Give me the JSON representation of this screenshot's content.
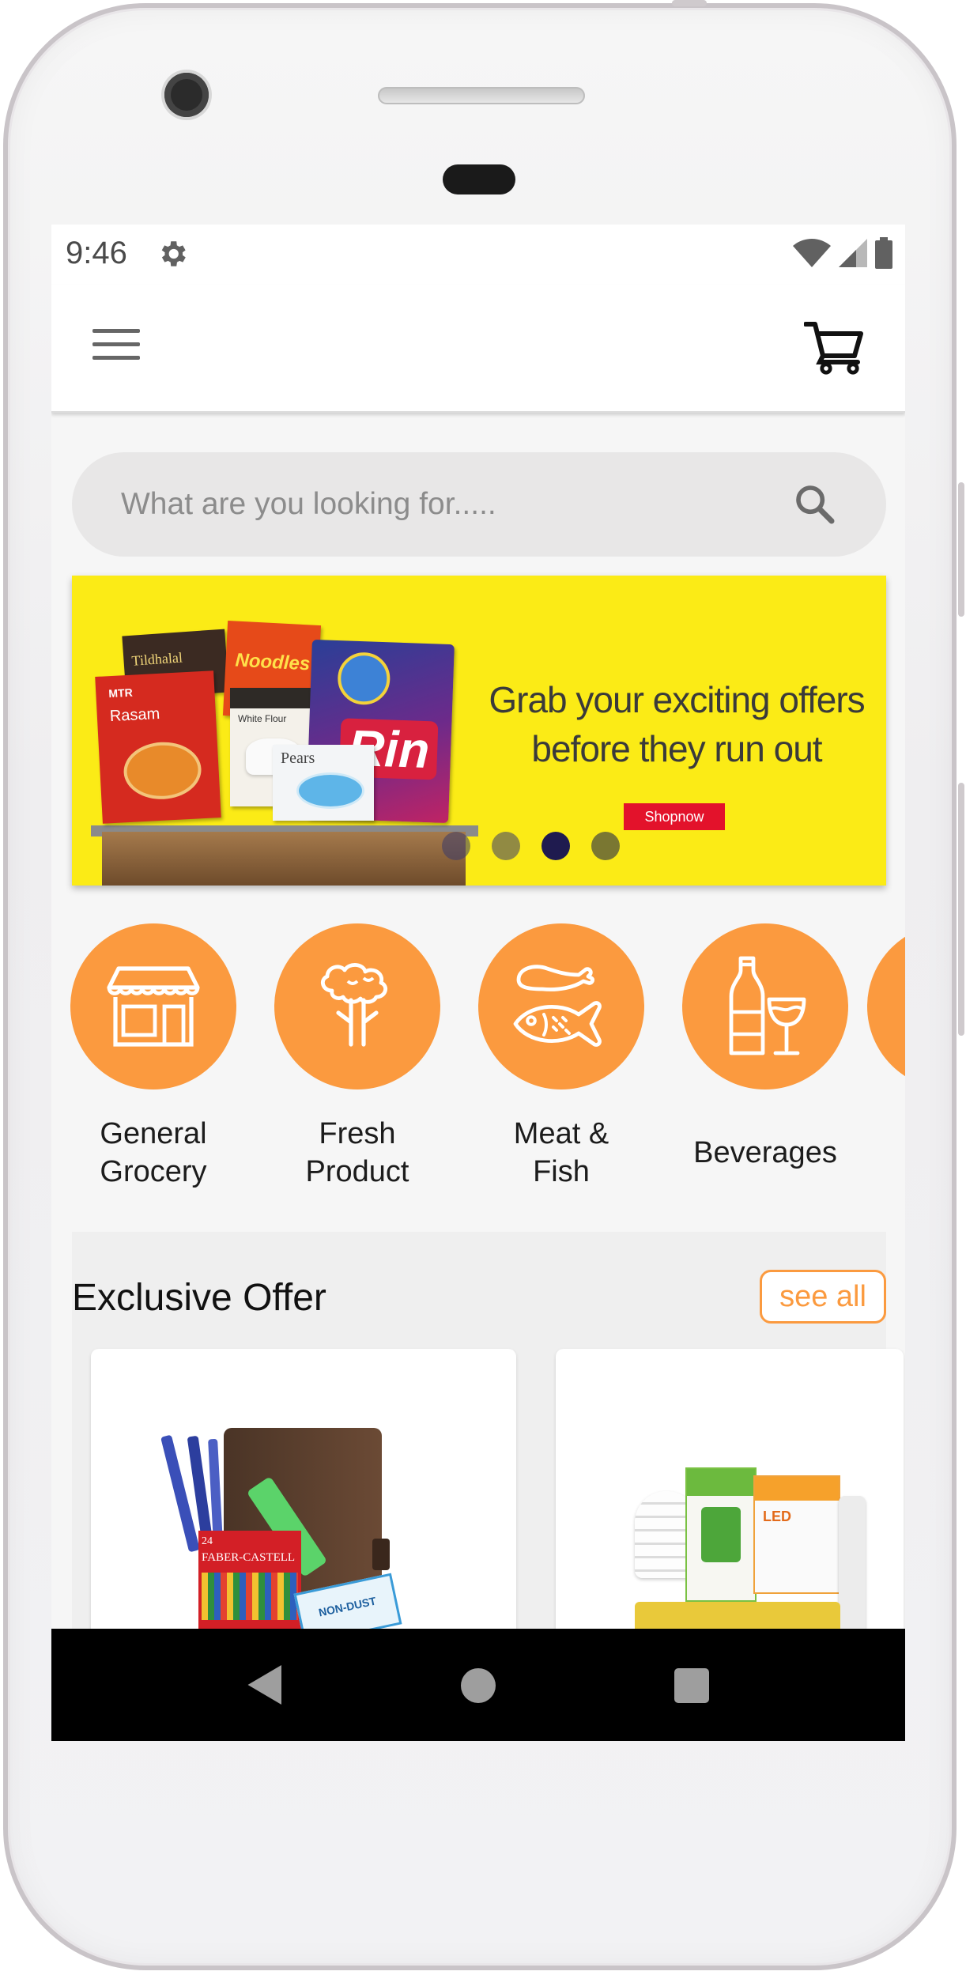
{
  "status_bar": {
    "time": "9:46",
    "icons": [
      "gear-icon",
      "wifi-icon",
      "signal-icon",
      "battery-icon"
    ]
  },
  "app_bar": {
    "menu_icon": "hamburger-menu-icon",
    "cart_icon": "shopping-cart-icon"
  },
  "search": {
    "placeholder": "What are you looking for.....",
    "value": "",
    "icon": "search-icon"
  },
  "banner": {
    "headline_line1": "Grab your exciting offers",
    "headline_line2": "before they run out",
    "cta_label": "Shopnow",
    "product_labels": [
      "Tildhalal",
      "Noodles",
      "Rasam",
      "MTR",
      "White Flour",
      "Pears",
      "Rin"
    ],
    "slide_count": 4,
    "active_slide": 3
  },
  "categories": [
    {
      "label": "General Grocery",
      "icon": "storefront-icon"
    },
    {
      "label": "Fresh Product",
      "icon": "broccoli-icon"
    },
    {
      "label": "Meat & Fish",
      "icon": "meat-fish-icon"
    },
    {
      "label": "Beverages",
      "icon": "bottle-glass-icon"
    }
  ],
  "offers": {
    "title": "Exclusive Offer",
    "see_all_label": "see all",
    "cards": [
      {
        "product_labels": [
          "FABER-CASTELL",
          "24",
          "NON-DUST"
        ]
      },
      {
        "product_labels": [
          "LED"
        ]
      }
    ]
  },
  "nav_bar": {
    "buttons": [
      "back-icon",
      "home-icon",
      "recents-icon"
    ]
  },
  "colors": {
    "accent": "#fb9a3f",
    "banner_bg": "#fbeb16",
    "cta_red": "#e3122b",
    "nav_bg": "#000000"
  }
}
